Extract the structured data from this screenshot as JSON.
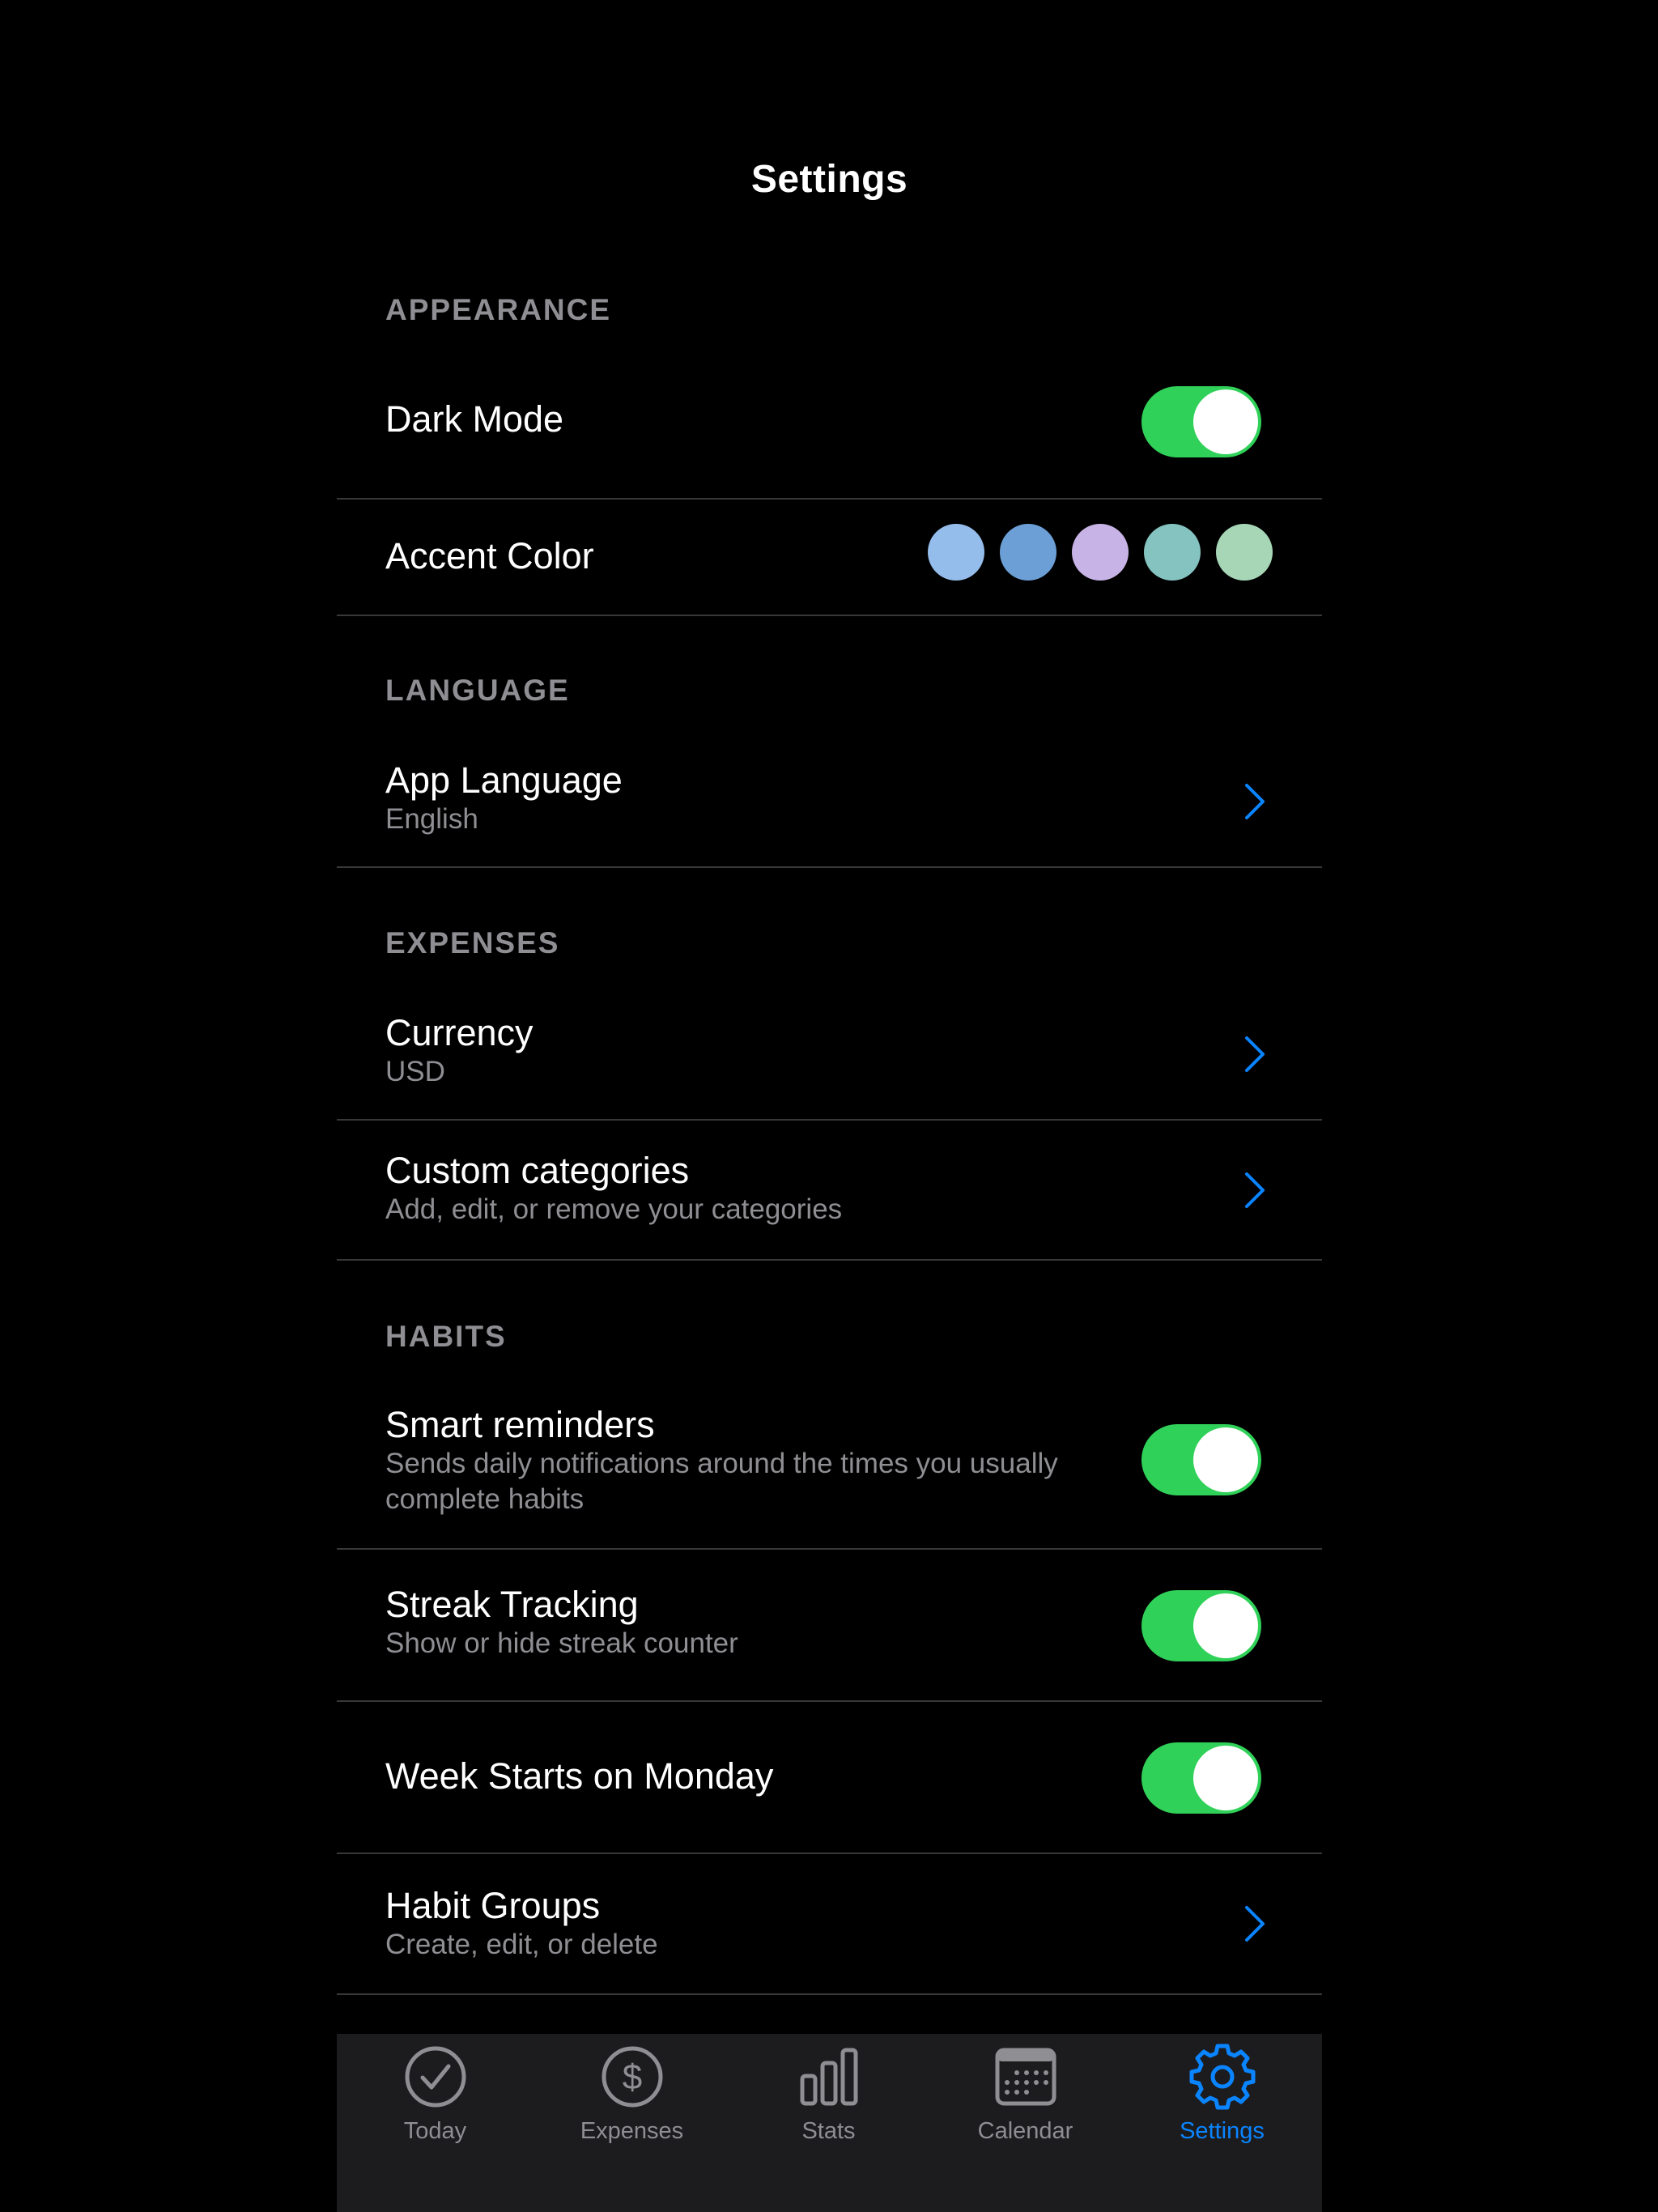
{
  "header": {
    "title": "Settings"
  },
  "sections": {
    "appearance": "APPEARANCE",
    "language": "LANGUAGE",
    "expenses": "EXPENSES",
    "habits": "HABITS"
  },
  "rows": {
    "dark_mode": {
      "title": "Dark Mode",
      "on": true
    },
    "accent_color": {
      "title": "Accent Color",
      "swatches": [
        "#95bdeb",
        "#6b9fd6",
        "#c8b3e6",
        "#84c3c0",
        "#a7d6b7"
      ]
    },
    "app_language": {
      "title": "App Language",
      "value": "English"
    },
    "currency": {
      "title": "Currency",
      "value": "USD"
    },
    "custom_categories": {
      "title": "Custom categories",
      "subtitle": "Add, edit, or remove your categories"
    },
    "smart_reminders": {
      "title": "Smart reminders",
      "subtitle": "Sends daily notifications around the times you usually complete habits",
      "on": true
    },
    "streak_tracking": {
      "title": "Streak Tracking",
      "subtitle": "Show or hide streak counter",
      "on": true
    },
    "week_starts_monday": {
      "title": "Week Starts on Monday",
      "on": true
    },
    "habit_groups": {
      "title": "Habit Groups",
      "subtitle": "Create, edit, or delete"
    }
  },
  "tabbar": {
    "items": [
      {
        "label": "Today",
        "icon": "checkmark-circle-icon"
      },
      {
        "label": "Expenses",
        "icon": "dollar-circle-icon"
      },
      {
        "label": "Stats",
        "icon": "bar-chart-icon"
      },
      {
        "label": "Calendar",
        "icon": "calendar-icon"
      },
      {
        "label": "Settings",
        "icon": "gear-icon"
      }
    ],
    "active": "Settings"
  },
  "colors": {
    "background": "#000000",
    "toggle_on": "#30d158",
    "accent": "#0a84ff",
    "secondary_text": "#8e8e93",
    "divider": "#38383a",
    "tabbar_bg": "#1c1c1e"
  }
}
